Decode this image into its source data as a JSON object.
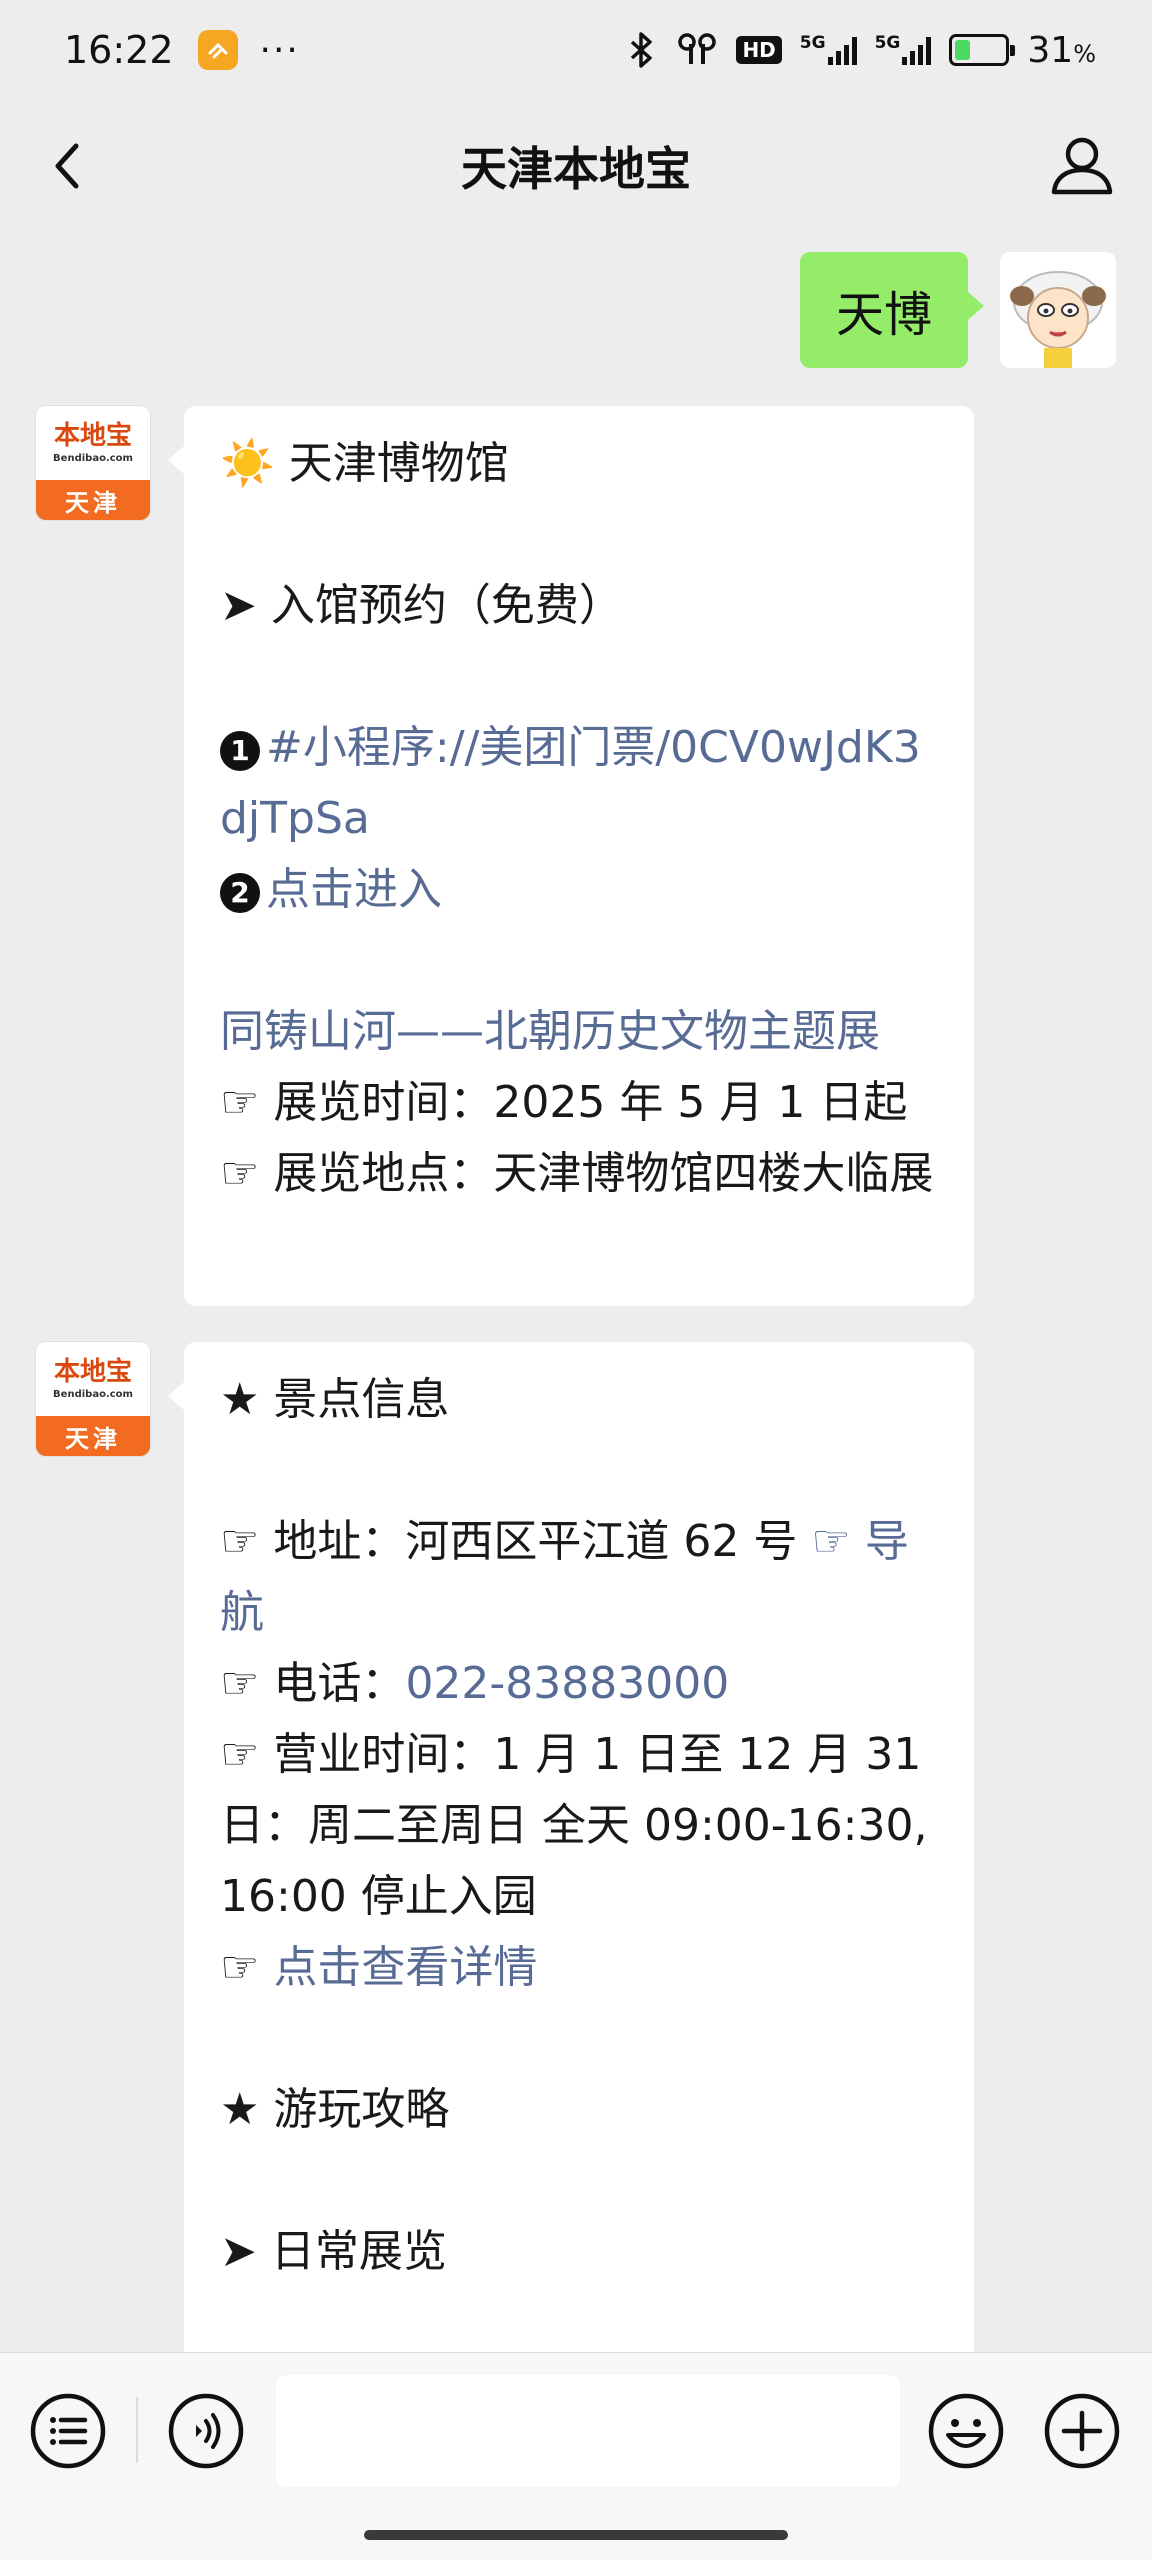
{
  "status_bar": {
    "time": "16:22",
    "dots": "···",
    "hd_label": "HD",
    "signal1_label": "5G",
    "signal2_label": "5G",
    "battery_percent": "31",
    "battery_percent_sign": "%",
    "battery_level": 0.31
  },
  "header": {
    "title": "天津本地宝"
  },
  "messages": {
    "user_text": "天博",
    "bot1": {
      "line1_emoji": "☀️",
      "line1_text": " 天津博物馆",
      "line2": "➤ 入馆预约（免费）",
      "line3_num": "1",
      "line3_link": "#小程序://美团门票/0CV0wJdK3djTpSa",
      "line4_num": "2",
      "line4_link": "点击进入",
      "line5_link": "同铸山河——北朝历史文物主题展",
      "line6": "☞ 展览时间：2025 年 5 月 1 日起",
      "line7": "☞ 展览地点：天津博物馆四楼大临展"
    },
    "bot2": {
      "line1": "★ 景点信息",
      "line2_text": "☞ 地址：河西区平江道 62 号 ",
      "line2_link": "☞ 导航",
      "line3_text": "☞ 电话：",
      "line3_link": "022-83883000",
      "line4": "☞ 营业时间：1 月 1 日至 12 月 31 日：周二至周日 全天 09:00-16:30,16:00 停止入园",
      "line5_icon": "☞ ",
      "line5_link": "点击查看详情",
      "line6": "★ 游玩攻略",
      "line7": "➤ 日常展览"
    },
    "bot_avatar": {
      "logo": "本地宝",
      "url": "Bendibao.com",
      "city": "天津"
    }
  },
  "input_bar": {
    "placeholder": ""
  },
  "icons": {
    "back": "chevron-left-icon",
    "user": "person-icon",
    "menu": "list-menu-icon",
    "voice": "voice-icon",
    "emoji": "emoji-icon",
    "plus": "plus-icon"
  },
  "colors": {
    "user_bubble": "#95ec69",
    "link": "#576b95",
    "background": "#ededed",
    "bot_avatar_orange": "#f26b21"
  }
}
